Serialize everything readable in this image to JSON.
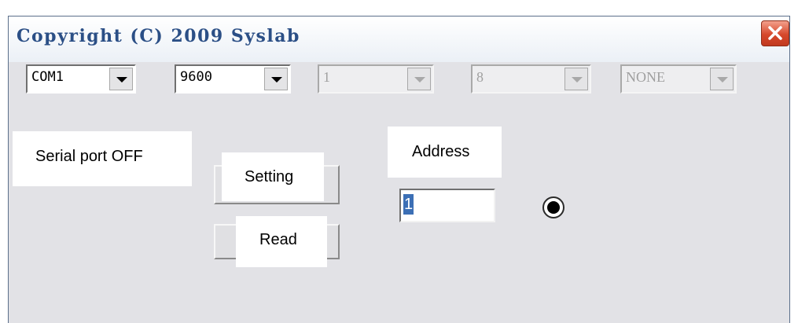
{
  "window": {
    "title": "Copyright (C) 2009 Syslab"
  },
  "port_combo": {
    "value": "COM1"
  },
  "baud_combo": {
    "value": "9600"
  },
  "databits_combo": {
    "value": "1"
  },
  "stopbits_combo": {
    "value": "8"
  },
  "parity_combo": {
    "value": "NONE"
  },
  "status": {
    "text": "Serial port OFF"
  },
  "buttons": {
    "setting": "Setting",
    "read": "Read"
  },
  "address": {
    "label": "Address",
    "value": "1"
  },
  "colors": {
    "title_text": "#2b4f86",
    "close": "#d6482b",
    "window_bg": "#e2e2e6",
    "selection": "#3c6fb5"
  }
}
